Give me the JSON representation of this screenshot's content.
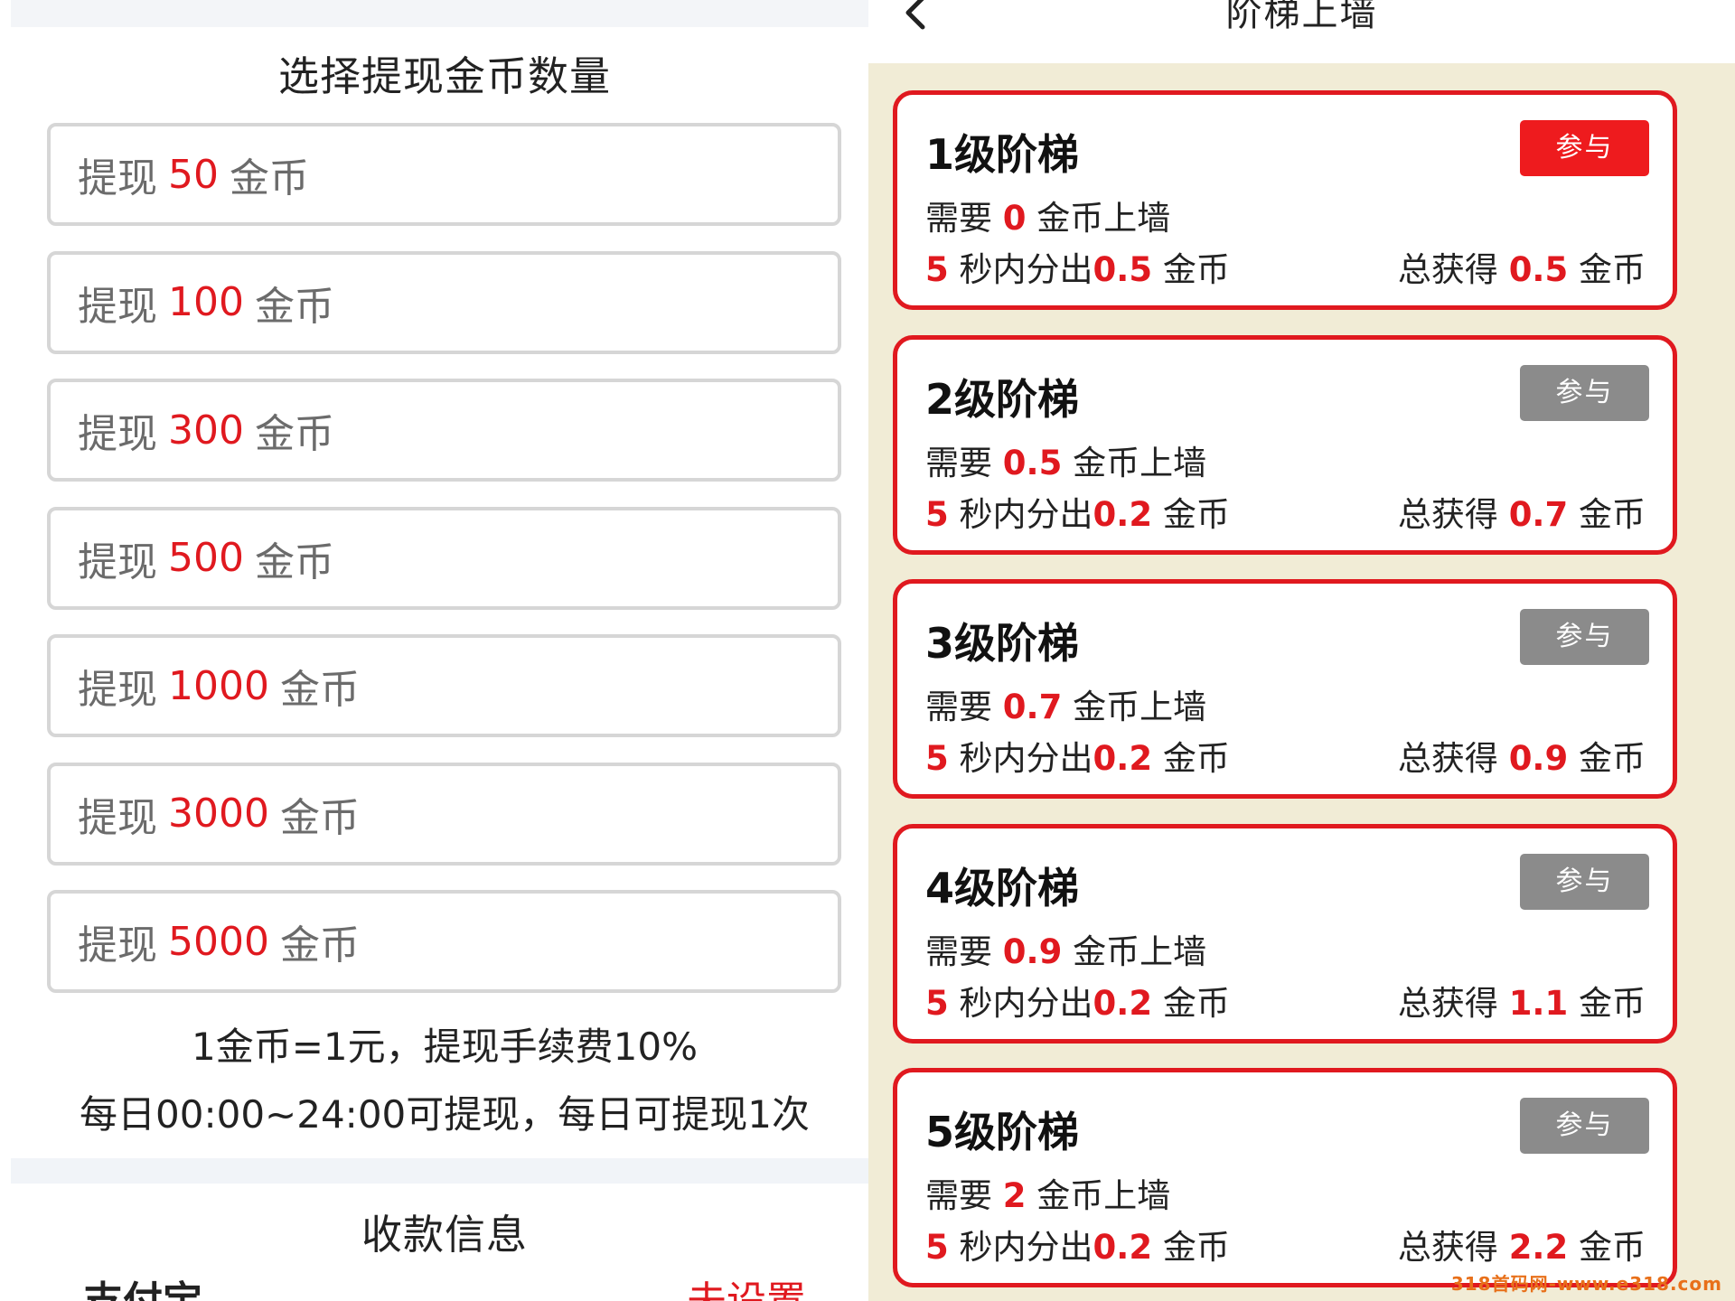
{
  "left_panel": {
    "section_title": "选择提现金币数量",
    "amount_prefix": "提现",
    "amount_suffix": "金币",
    "amounts": [
      "50",
      "100",
      "300",
      "500",
      "1000",
      "3000",
      "5000"
    ],
    "note_rate": "1金币=1元，提现手续费10%",
    "note_time": "每日00:00~24:00可提现，每日可提现1次",
    "payment_title": "收款信息",
    "payment_method": "支付宝",
    "payment_status": "未设置"
  },
  "right_panel": {
    "header_title": "阶梯上墙",
    "back_icon": "chevron-left-icon",
    "tiers": [
      {
        "name": "1级阶梯",
        "button": "参与",
        "button_state": "active",
        "need_prefix": "需要 ",
        "need_value": "0",
        "need_suffix": " 金币上墙",
        "split_seconds": "5",
        "split_middle": " 秒内分出",
        "split_value": "0.5",
        "split_suffix": " 金币",
        "total_prefix": "总获得 ",
        "total_value": "0.5",
        "total_suffix": " 金币"
      },
      {
        "name": "2级阶梯",
        "button": "参与",
        "button_state": "disabled",
        "need_prefix": "需要 ",
        "need_value": "0.5",
        "need_suffix": " 金币上墙",
        "split_seconds": "5",
        "split_middle": " 秒内分出",
        "split_value": "0.2",
        "split_suffix": " 金币",
        "total_prefix": "总获得 ",
        "total_value": "0.7",
        "total_suffix": " 金币"
      },
      {
        "name": "3级阶梯",
        "button": "参与",
        "button_state": "disabled",
        "need_prefix": "需要 ",
        "need_value": "0.7",
        "need_suffix": " 金币上墙",
        "split_seconds": "5",
        "split_middle": " 秒内分出",
        "split_value": "0.2",
        "split_suffix": " 金币",
        "total_prefix": "总获得 ",
        "total_value": "0.9",
        "total_suffix": " 金币"
      },
      {
        "name": "4级阶梯",
        "button": "参与",
        "button_state": "disabled",
        "need_prefix": "需要 ",
        "need_value": "0.9",
        "need_suffix": " 金币上墙",
        "split_seconds": "5",
        "split_middle": " 秒内分出",
        "split_value": "0.2",
        "split_suffix": " 金币",
        "total_prefix": "总获得 ",
        "total_value": "1.1",
        "total_suffix": " 金币"
      },
      {
        "name": "5级阶梯",
        "button": "参与",
        "button_state": "disabled",
        "need_prefix": "需要 ",
        "need_value": "2",
        "need_suffix": " 金币上墙",
        "split_seconds": "5",
        "split_middle": " 秒内分出",
        "split_value": "0.2",
        "split_suffix": " 金币",
        "total_prefix": "总获得 ",
        "total_value": "2.2",
        "total_suffix": " 金币"
      }
    ]
  },
  "watermark": "318首码网-www.e318.com",
  "colors": {
    "accent_red": "#e0191f",
    "button_gray": "#8b8b8b",
    "panel_bg": "#f1ecd6"
  }
}
